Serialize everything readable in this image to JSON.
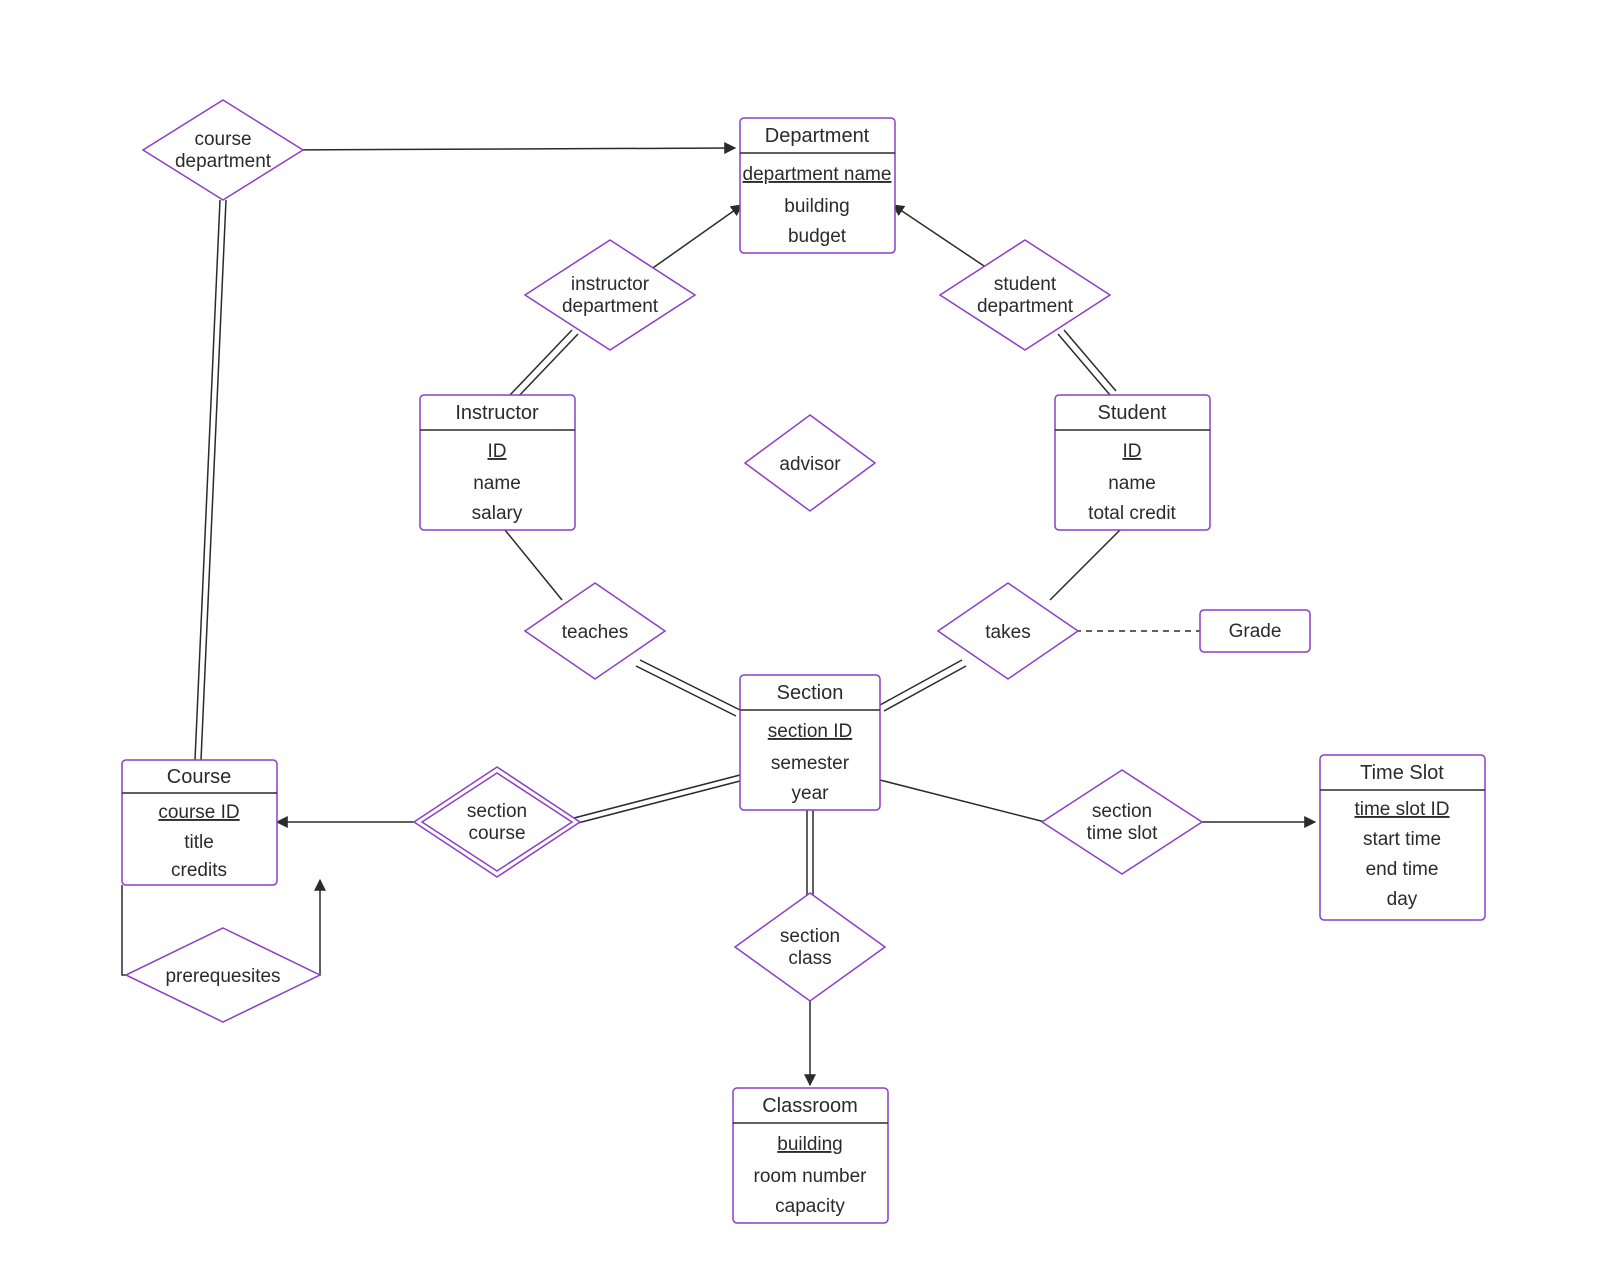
{
  "entities": {
    "department": {
      "title": "Department",
      "key": "department name",
      "attrs": [
        "building",
        "budget"
      ]
    },
    "instructor": {
      "title": "Instructor",
      "key": "ID",
      "attrs": [
        "name",
        "salary"
      ]
    },
    "student": {
      "title": "Student",
      "key": "ID",
      "attrs": [
        "name",
        "total credit"
      ]
    },
    "section": {
      "title": "Section",
      "key": "section ID",
      "attrs": [
        "semester",
        "year"
      ]
    },
    "course": {
      "title": "Course",
      "key": "course ID",
      "attrs": [
        "title",
        "credits"
      ]
    },
    "classroom": {
      "title": "Classroom",
      "key": "building",
      "attrs": [
        "room number",
        "capacity"
      ]
    },
    "timeslot": {
      "title": "Time Slot",
      "key": "time slot ID",
      "attrs": [
        "start time",
        "end time",
        "day"
      ]
    }
  },
  "relationships": {
    "course_department": {
      "label1": "course",
      "label2": "department"
    },
    "instructor_department": {
      "label1": "instructor",
      "label2": "department"
    },
    "student_department": {
      "label1": "student",
      "label2": "department"
    },
    "advisor": {
      "label1": "advisor",
      "label2": ""
    },
    "teaches": {
      "label1": "teaches",
      "label2": ""
    },
    "takes": {
      "label1": "takes",
      "label2": ""
    },
    "section_course": {
      "label1": "section",
      "label2": "course"
    },
    "section_timeslot": {
      "label1": "section",
      "label2": "time slot"
    },
    "section_class": {
      "label1": "section",
      "label2": "class"
    },
    "prerequisites": {
      "label1": "prerequesites",
      "label2": ""
    }
  },
  "attr_box": {
    "grade": "Grade"
  },
  "colors": {
    "stroke": "#8b3fc7",
    "text": "#2b2b2b"
  }
}
